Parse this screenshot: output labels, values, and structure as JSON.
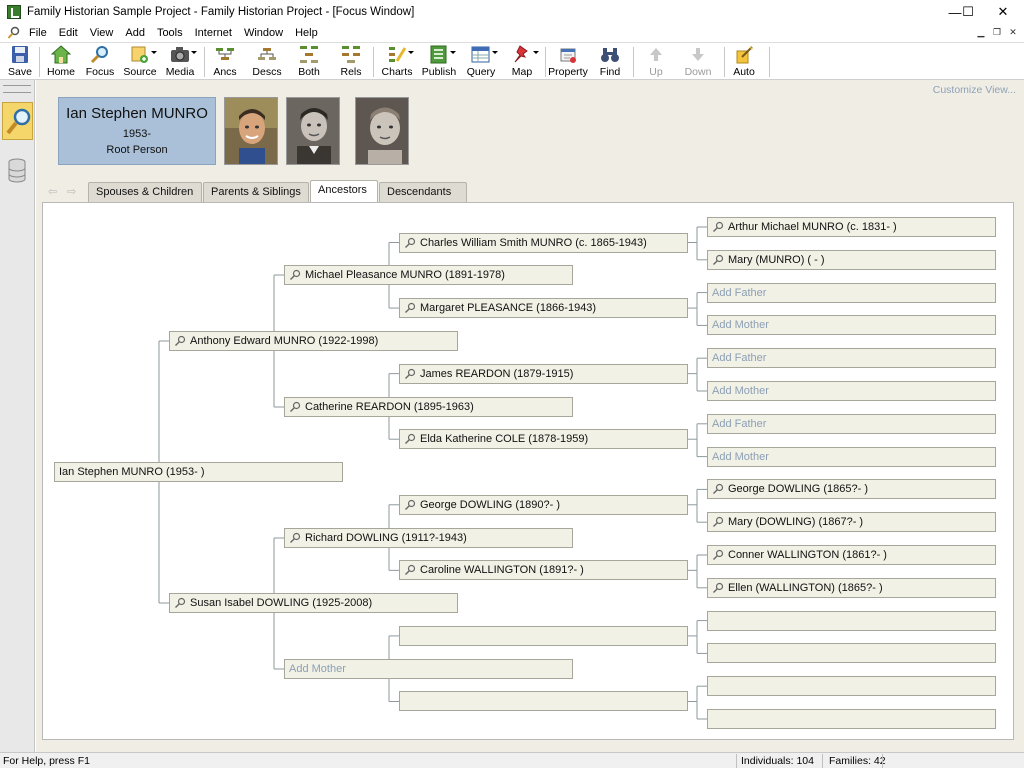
{
  "window": {
    "title": "Family Historian Sample Project - Family Historian Project - [Focus Window]",
    "minimize": "—",
    "maximize": "☐",
    "close": "✕"
  },
  "menu": [
    "File",
    "Edit",
    "View",
    "Add",
    "Tools",
    "Internet",
    "Window",
    "Help"
  ],
  "toolbar": {
    "save": "Save",
    "home": "Home",
    "focus": "Focus",
    "source": "Source",
    "media": "Media",
    "ancs": "Ancs",
    "descs": "Descs",
    "both": "Both",
    "rels": "Rels",
    "charts": "Charts",
    "publish": "Publish",
    "query": "Query",
    "map": "Map",
    "property": "Property",
    "find": "Find",
    "up": "Up",
    "down": "Down",
    "auto": "Auto"
  },
  "customize": "Customize View...",
  "root_person": {
    "name": "Ian Stephen MUNRO",
    "birth": "1953-",
    "role": "Root Person"
  },
  "tabs": {
    "spouses": "Spouses & Children",
    "parents": "Parents & Siblings",
    "ancestors": "Ancestors",
    "descendants": "Descendants"
  },
  "tree": {
    "g0": "Ian Stephen MUNRO (1953- )",
    "g1": [
      "Anthony Edward MUNRO (1922-1998)",
      "Susan Isabel DOWLING (1925-2008)"
    ],
    "g2": [
      "Michael Pleasance MUNRO (1891-1978)",
      "Catherine REARDON (1895-1963)",
      "Richard DOWLING (1911?-1943)",
      "Add Mother"
    ],
    "g3": [
      "Charles William Smith MUNRO (c. 1865-1943)",
      "Margaret PLEASANCE (1866-1943)",
      "James REARDON (1879-1915)",
      "Elda Katherine COLE (1878-1959)",
      "George DOWLING (1890?- )",
      "Caroline WALLINGTON (1891?- )",
      "",
      ""
    ],
    "g4": [
      "Arthur Michael MUNRO (c. 1831- )",
      "Mary (MUNRO) ( - )",
      "Add Father",
      "Add Mother",
      "Add Father",
      "Add Mother",
      "Add Father",
      "Add Mother",
      "George DOWLING (1865?- )",
      "Mary (DOWLING) (1867?- )",
      "Conner WALLINGTON (1861?- )",
      "Ellen (WALLINGTON) (1865?- )",
      "",
      "",
      "",
      ""
    ]
  },
  "status": {
    "help": "For Help, press F1",
    "individuals": "Individuals: 104",
    "families": "Families: 42"
  }
}
